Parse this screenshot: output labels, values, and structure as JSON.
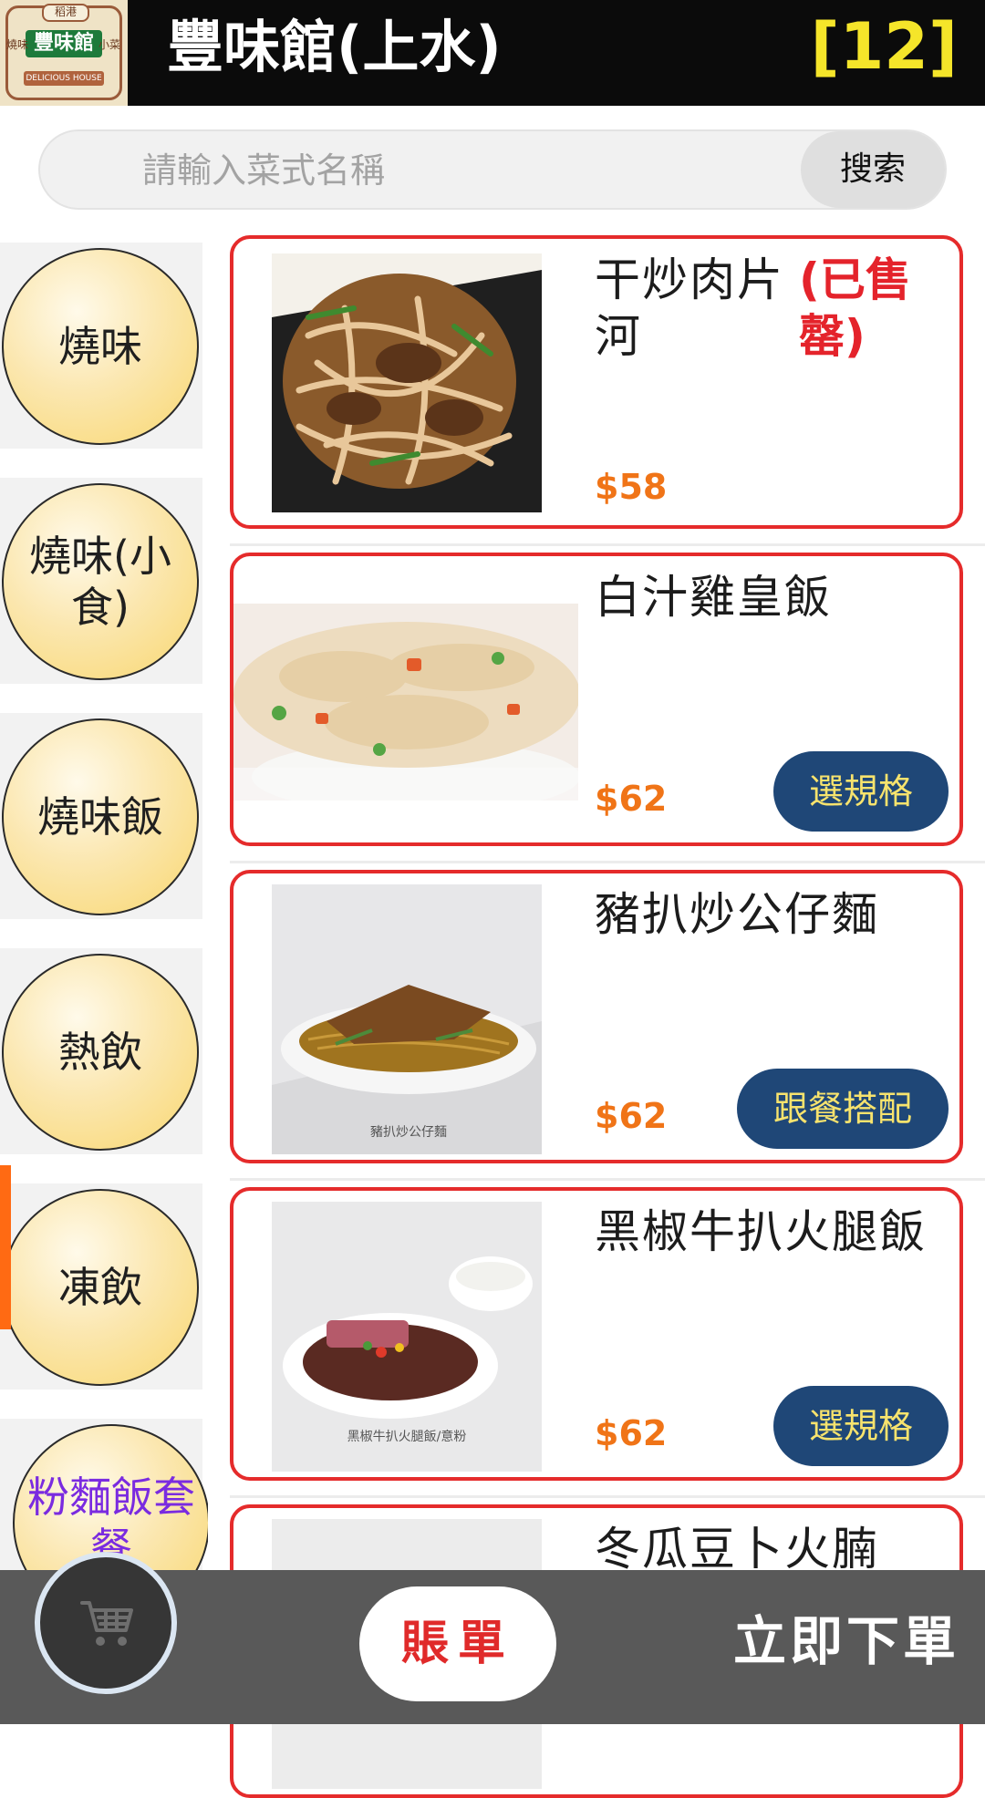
{
  "header": {
    "logo": {
      "top_text": "稻港",
      "name": "豐味館",
      "left_text": "燒味",
      "right_text": "小菜",
      "english": "DELICIOUS HOUSE"
    },
    "title": "豐味館(上水)",
    "table_number": "[12]"
  },
  "search": {
    "placeholder": "請輸入菜式名稱",
    "button_label": "搜索"
  },
  "sidebar": {
    "categories": [
      {
        "label": "燒味"
      },
      {
        "label": "燒味(小食)"
      },
      {
        "label": "燒味飯"
      },
      {
        "label": "熱飲"
      },
      {
        "label": "凍飲"
      },
      {
        "label": "粉麵飯套餐"
      }
    ],
    "active_index": 5
  },
  "dishes": [
    {
      "name": "干炒肉片河",
      "status": "(已售罄)",
      "price": "$58",
      "button": ""
    },
    {
      "name": "白汁雞皇飯",
      "status": "",
      "price": "$62",
      "button": "選規格"
    },
    {
      "name": "豬扒炒公仔麵",
      "status": "",
      "price": "$62",
      "button": "跟餐搭配",
      "image_caption": "豬扒炒公仔麵"
    },
    {
      "name": "黑椒牛扒火腿飯",
      "status": "",
      "price": "$62",
      "button": "選規格",
      "image_caption": "黑椒牛扒火腿飯/意粉"
    },
    {
      "name": "冬瓜豆卜火腩",
      "status": "",
      "price": "",
      "button": ""
    }
  ],
  "bottom_bar": {
    "cart_icon": "shopping-cart-icon",
    "bill_label": "賬單",
    "order_label": "立即下單"
  },
  "colors": {
    "header_bg": "#0b0b0b",
    "table_number": "#f5e52a",
    "card_border": "#e52b2b",
    "price": "#f07417",
    "sold_out": "#e4232b",
    "button_bg": "#1f4777",
    "button_text": "#f7e36d",
    "active_category": "#7a2be0",
    "active_indicator": "#ff6a13"
  }
}
